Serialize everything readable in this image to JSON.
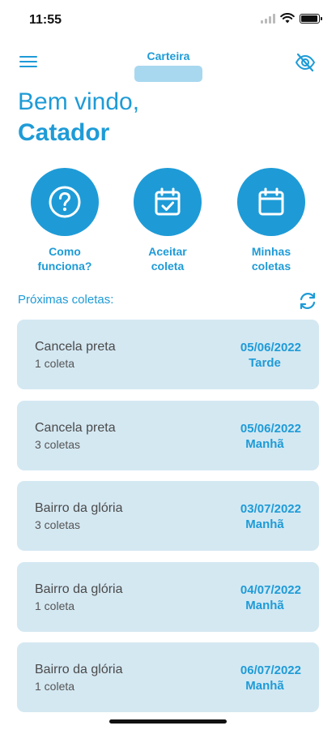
{
  "status_bar": {
    "time": "11:55",
    "battery_level": 0.95
  },
  "header": {
    "wallet_label": "Carteira",
    "menu_icon": "hamburger-menu-icon",
    "visibility_icon": "eye-off-icon"
  },
  "greeting": {
    "line1": "Bem vindo,",
    "line2": "Catador"
  },
  "actions": [
    {
      "label": "Como\nfunciona?",
      "icon": "question-icon"
    },
    {
      "label": "Aceitar\ncoleta",
      "icon": "calendar-check-icon"
    },
    {
      "label": "Minhas\ncoletas",
      "icon": "calendar-icon"
    }
  ],
  "section": {
    "title": "Próximas coletas:",
    "refresh_icon": "refresh-icon"
  },
  "collections": [
    {
      "place": "Cancela preta",
      "count": "1 coleta",
      "date": "05/06/2022",
      "period": "Tarde"
    },
    {
      "place": "Cancela preta",
      "count": "3 coletas",
      "date": "05/06/2022",
      "period": "Manhã"
    },
    {
      "place": "Bairro da glória",
      "count": "3 coletas",
      "date": "03/07/2022",
      "period": "Manhã"
    },
    {
      "place": "Bairro da glória",
      "count": "1 coleta",
      "date": "04/07/2022",
      "period": "Manhã"
    },
    {
      "place": "Bairro da glória",
      "count": "1 coleta",
      "date": "06/07/2022",
      "period": "Manhã"
    }
  ],
  "colors": {
    "accent": "#1e9bd7",
    "card_bg": "#d4e8f2",
    "wallet_mask": "#a8d8ef"
  }
}
